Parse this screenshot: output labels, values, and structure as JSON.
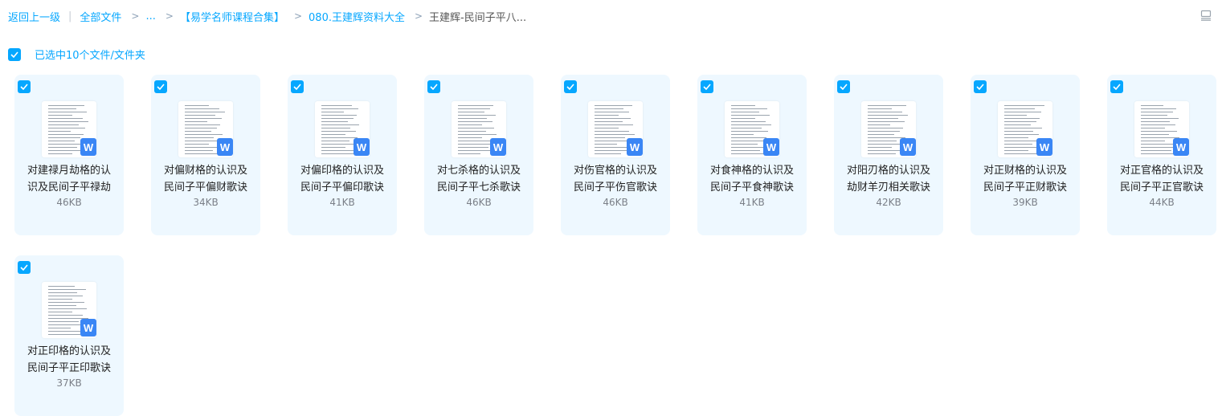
{
  "breadcrumb": {
    "back": "返回上一级",
    "all_files": "全部文件",
    "ellipsis": "...",
    "folder1": "【易学名师课程合集】",
    "folder2": "080.王建辉资料大全",
    "current": "王建辉-民间子平八..."
  },
  "selection": {
    "label": "已选中10个文件/文件夹",
    "checked": true
  },
  "colors": {
    "accent": "#06a7ff",
    "card_bg": "#eef8ff",
    "word_icon": "#3a86f5"
  },
  "files": [
    {
      "name": "对建禄月劫格的认识及民间子平禄劫",
      "size": "46KB",
      "icon": "word-icon"
    },
    {
      "name": "对偏财格的认识及民间子平偏财歌诀",
      "size": "34KB",
      "icon": "word-icon"
    },
    {
      "name": "对偏印格的认识及民间子平偏印歌诀",
      "size": "41KB",
      "icon": "word-icon"
    },
    {
      "name": "对七杀格的认识及民间子平七杀歌诀",
      "size": "46KB",
      "icon": "word-icon"
    },
    {
      "name": "对伤官格的认识及民间子平伤官歌诀",
      "size": "46KB",
      "icon": "word-icon"
    },
    {
      "name": "对食神格的认识及民间子平食神歌诀",
      "size": "41KB",
      "icon": "word-icon"
    },
    {
      "name": "对阳刃格的认识及劫财羊刃相关歌诀",
      "size": "42KB",
      "icon": "word-icon"
    },
    {
      "name": "对正财格的认识及民间子平正财歌诀",
      "size": "39KB",
      "icon": "word-icon"
    },
    {
      "name": "对正官格的认识及民间子平正官歌诀",
      "size": "44KB",
      "icon": "word-icon"
    },
    {
      "name": "对正印格的认识及民间子平正印歌诀",
      "size": "37KB",
      "icon": "word-icon"
    }
  ]
}
